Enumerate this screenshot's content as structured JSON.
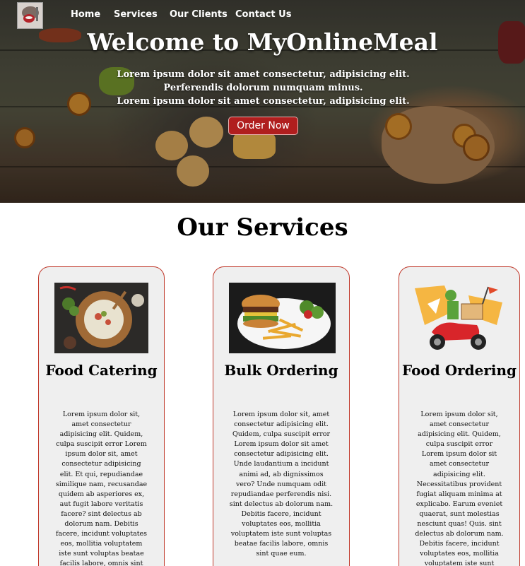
{
  "nav": {
    "logo_alt": "logo",
    "links": [
      "Home",
      "Services",
      "Our Clients",
      "Contact Us"
    ]
  },
  "hero": {
    "title": "Welcome to MyOnlineMeal",
    "subtitle_line1": "Lorem ipsum dolor sit amet consectetur, adipisicing elit. Perferendis dolorum numquam minus.",
    "subtitle_line2": "Lorem ipsum dolor sit amet consectetur, adipisicing elit.",
    "button": "Order Now"
  },
  "services": {
    "title": "Our Services",
    "cards": [
      {
        "title": "Food Catering",
        "text": "Lorem ipsum dolor sit, amet consectetur adipisicing elit. Quidem, culpa suscipit error Lorem ipsum dolor sit, amet consectetur adipisicing elit. Et qui, repudiandae similique nam, recusandae quidem ab asperiores ex, aut fugit labore veritatis facere? sint delectus ab dolorum nam. Debitis facere, incidunt voluptates eos, mollitia voluptatem iste sunt voluptas beatae facilis labore, omnis sint quae eum."
      },
      {
        "title": "Bulk Ordering",
        "text": "Lorem ipsum dolor sit, amet consectetur adipisicing elit. Quidem, culpa suscipit error Lorem ipsum dolor sit amet consectetur adipisicing elit. Unde laudantium a incidunt animi ad, ab dignissimos vero? Unde numquam odit repudiandae perferendis nisi. sint delectus ab dolorum nam. Debitis facere, incidunt voluptates eos, mollitia voluptatem iste sunt voluptas beatae facilis labore, omnis sint quae eum."
      },
      {
        "title": "Food Ordering",
        "text": "Lorem ipsum dolor sit, amet consectetur adipisicing elit. Quidem, culpa suscipit error Lorem ipsum dolor sit amet consectetur adipisicing elit. Necessitatibus provident fugiat aliquam minima at explicabo. Earum eveniet quaerat, sunt molestias nesciunt quas! Quis. sint delectus ab dolorum nam. Debitis facere, incidunt voluptates eos, mollitia voluptatem iste sunt voluptas beatae facilis"
      }
    ]
  },
  "colors": {
    "accent_red": "#b01e1e",
    "card_border": "#c0392b",
    "card_bg": "#efefef"
  }
}
